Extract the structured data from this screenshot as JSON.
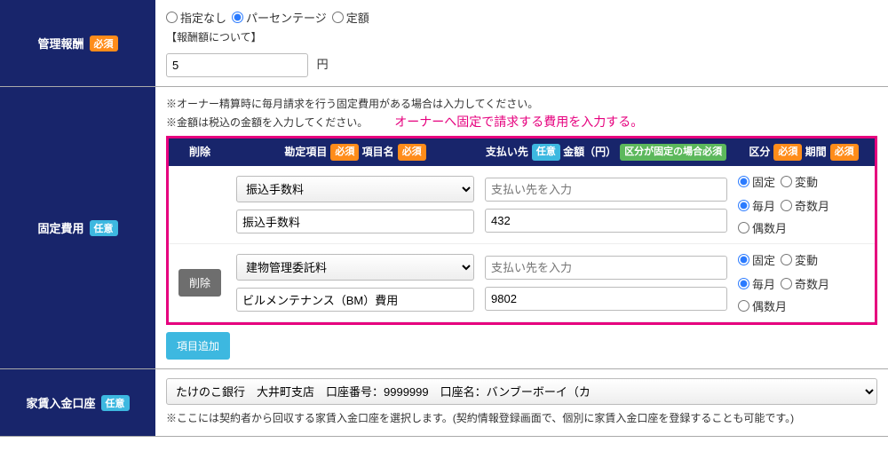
{
  "row1": {
    "label": "管理報酬",
    "badge": "必須",
    "radios": [
      "指定なし",
      "パーセンテージ",
      "定額"
    ],
    "selected": 1,
    "note": "【報酬額について】",
    "input_value": "5",
    "unit": "円"
  },
  "row2": {
    "label": "固定費用",
    "badge": "任意",
    "note1": "※オーナー精算時に毎月請求を行う固定費用がある場合は入力してください。",
    "note2": "※金額は税込の金額を入力してください。",
    "callout": "オーナーへ固定で請求する費用を入力する。",
    "th": {
      "del": "削除",
      "item_a": "勘定項目",
      "item_a_badge": "必須",
      "item_b": "項目名",
      "item_b_badge": "必須",
      "pay_a": "支払い先",
      "pay_a_badge": "任意",
      "pay_b": "金額（円）",
      "pay_b_badge": "区分が固定の場合必須",
      "opt_a": "区分",
      "opt_a_badge": "必須",
      "opt_b": "期間",
      "opt_b_badge": "必須"
    },
    "rows": [
      {
        "del_btn": "",
        "select": "振込手数料",
        "name": "振込手数料",
        "payee": "",
        "payee_ph": "支払い先を入力",
        "amount": "432",
        "kubun": [
          "固定",
          "変動"
        ],
        "kubun_sel": 0,
        "kikan": [
          "毎月",
          "奇数月",
          "偶数月"
        ],
        "kikan_sel": 0
      },
      {
        "del_btn": "削除",
        "select": "建物管理委託料",
        "name": "ビルメンテナンス（BM）費用",
        "payee": "",
        "payee_ph": "支払い先を入力",
        "amount": "9802",
        "kubun": [
          "固定",
          "変動"
        ],
        "kubun_sel": 0,
        "kikan": [
          "毎月",
          "奇数月",
          "偶数月"
        ],
        "kikan_sel": 0
      }
    ],
    "add_btn": "項目追加"
  },
  "row3": {
    "label": "家賃入金口座",
    "badge": "任意",
    "select": "たけのこ銀行　大井町支店　口座番号：9999999　口座名：バンブーボーイ（カ",
    "note": "※ここには契約者から回収する家賃入金口座を選択します。(契約情報登録画面で、個別に家賃入金口座を登録することも可能です。)"
  }
}
